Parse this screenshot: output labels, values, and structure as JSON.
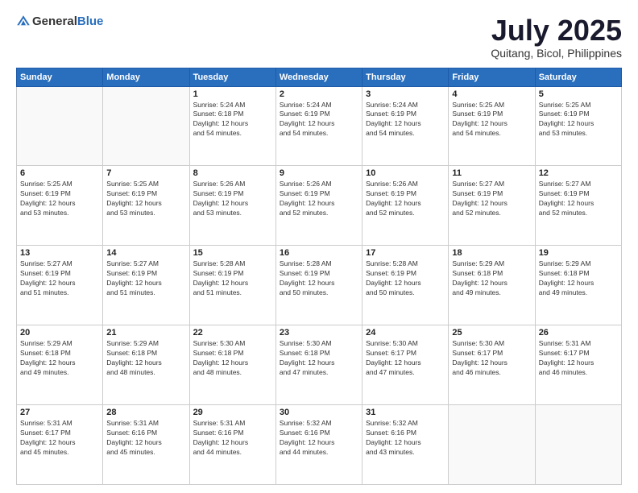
{
  "header": {
    "logo_general": "General",
    "logo_blue": "Blue",
    "month": "July 2025",
    "location": "Quitang, Bicol, Philippines"
  },
  "weekdays": [
    "Sunday",
    "Monday",
    "Tuesday",
    "Wednesday",
    "Thursday",
    "Friday",
    "Saturday"
  ],
  "weeks": [
    [
      {
        "day": "",
        "info": ""
      },
      {
        "day": "",
        "info": ""
      },
      {
        "day": "1",
        "info": "Sunrise: 5:24 AM\nSunset: 6:18 PM\nDaylight: 12 hours\nand 54 minutes."
      },
      {
        "day": "2",
        "info": "Sunrise: 5:24 AM\nSunset: 6:19 PM\nDaylight: 12 hours\nand 54 minutes."
      },
      {
        "day": "3",
        "info": "Sunrise: 5:24 AM\nSunset: 6:19 PM\nDaylight: 12 hours\nand 54 minutes."
      },
      {
        "day": "4",
        "info": "Sunrise: 5:25 AM\nSunset: 6:19 PM\nDaylight: 12 hours\nand 54 minutes."
      },
      {
        "day": "5",
        "info": "Sunrise: 5:25 AM\nSunset: 6:19 PM\nDaylight: 12 hours\nand 53 minutes."
      }
    ],
    [
      {
        "day": "6",
        "info": "Sunrise: 5:25 AM\nSunset: 6:19 PM\nDaylight: 12 hours\nand 53 minutes."
      },
      {
        "day": "7",
        "info": "Sunrise: 5:25 AM\nSunset: 6:19 PM\nDaylight: 12 hours\nand 53 minutes."
      },
      {
        "day": "8",
        "info": "Sunrise: 5:26 AM\nSunset: 6:19 PM\nDaylight: 12 hours\nand 53 minutes."
      },
      {
        "day": "9",
        "info": "Sunrise: 5:26 AM\nSunset: 6:19 PM\nDaylight: 12 hours\nand 52 minutes."
      },
      {
        "day": "10",
        "info": "Sunrise: 5:26 AM\nSunset: 6:19 PM\nDaylight: 12 hours\nand 52 minutes."
      },
      {
        "day": "11",
        "info": "Sunrise: 5:27 AM\nSunset: 6:19 PM\nDaylight: 12 hours\nand 52 minutes."
      },
      {
        "day": "12",
        "info": "Sunrise: 5:27 AM\nSunset: 6:19 PM\nDaylight: 12 hours\nand 52 minutes."
      }
    ],
    [
      {
        "day": "13",
        "info": "Sunrise: 5:27 AM\nSunset: 6:19 PM\nDaylight: 12 hours\nand 51 minutes."
      },
      {
        "day": "14",
        "info": "Sunrise: 5:27 AM\nSunset: 6:19 PM\nDaylight: 12 hours\nand 51 minutes."
      },
      {
        "day": "15",
        "info": "Sunrise: 5:28 AM\nSunset: 6:19 PM\nDaylight: 12 hours\nand 51 minutes."
      },
      {
        "day": "16",
        "info": "Sunrise: 5:28 AM\nSunset: 6:19 PM\nDaylight: 12 hours\nand 50 minutes."
      },
      {
        "day": "17",
        "info": "Sunrise: 5:28 AM\nSunset: 6:19 PM\nDaylight: 12 hours\nand 50 minutes."
      },
      {
        "day": "18",
        "info": "Sunrise: 5:29 AM\nSunset: 6:18 PM\nDaylight: 12 hours\nand 49 minutes."
      },
      {
        "day": "19",
        "info": "Sunrise: 5:29 AM\nSunset: 6:18 PM\nDaylight: 12 hours\nand 49 minutes."
      }
    ],
    [
      {
        "day": "20",
        "info": "Sunrise: 5:29 AM\nSunset: 6:18 PM\nDaylight: 12 hours\nand 49 minutes."
      },
      {
        "day": "21",
        "info": "Sunrise: 5:29 AM\nSunset: 6:18 PM\nDaylight: 12 hours\nand 48 minutes."
      },
      {
        "day": "22",
        "info": "Sunrise: 5:30 AM\nSunset: 6:18 PM\nDaylight: 12 hours\nand 48 minutes."
      },
      {
        "day": "23",
        "info": "Sunrise: 5:30 AM\nSunset: 6:18 PM\nDaylight: 12 hours\nand 47 minutes."
      },
      {
        "day": "24",
        "info": "Sunrise: 5:30 AM\nSunset: 6:17 PM\nDaylight: 12 hours\nand 47 minutes."
      },
      {
        "day": "25",
        "info": "Sunrise: 5:30 AM\nSunset: 6:17 PM\nDaylight: 12 hours\nand 46 minutes."
      },
      {
        "day": "26",
        "info": "Sunrise: 5:31 AM\nSunset: 6:17 PM\nDaylight: 12 hours\nand 46 minutes."
      }
    ],
    [
      {
        "day": "27",
        "info": "Sunrise: 5:31 AM\nSunset: 6:17 PM\nDaylight: 12 hours\nand 45 minutes."
      },
      {
        "day": "28",
        "info": "Sunrise: 5:31 AM\nSunset: 6:16 PM\nDaylight: 12 hours\nand 45 minutes."
      },
      {
        "day": "29",
        "info": "Sunrise: 5:31 AM\nSunset: 6:16 PM\nDaylight: 12 hours\nand 44 minutes."
      },
      {
        "day": "30",
        "info": "Sunrise: 5:32 AM\nSunset: 6:16 PM\nDaylight: 12 hours\nand 44 minutes."
      },
      {
        "day": "31",
        "info": "Sunrise: 5:32 AM\nSunset: 6:16 PM\nDaylight: 12 hours\nand 43 minutes."
      },
      {
        "day": "",
        "info": ""
      },
      {
        "day": "",
        "info": ""
      }
    ]
  ]
}
